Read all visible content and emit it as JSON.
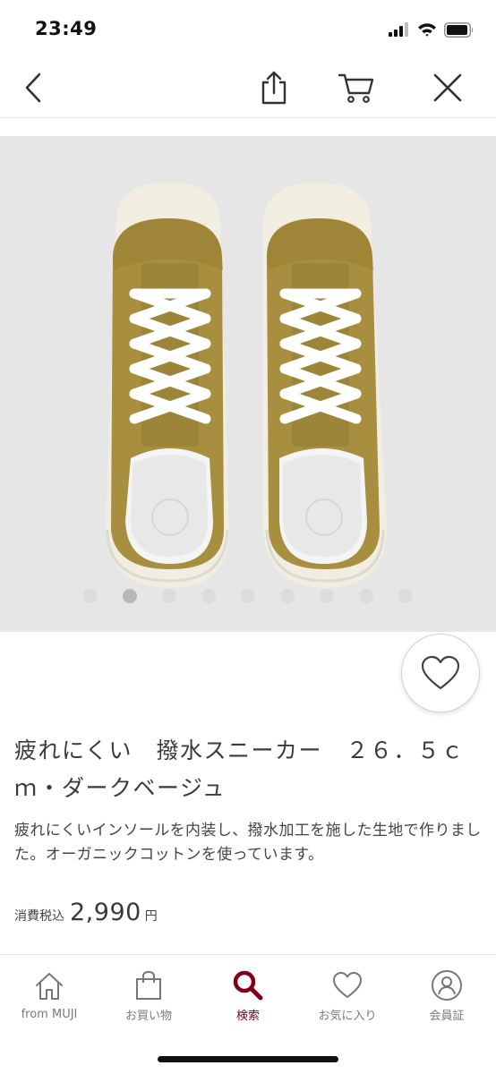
{
  "status_bar": {
    "time": "23:49"
  },
  "product": {
    "title": "疲れにくい　撥水スニーカー　２６．５ｃｍ・ダークベージュ",
    "description": "疲れにくいインソールを内装し、撥水加工を施した生地で作りました。オーガニックコットンを使っています。",
    "price_tax_label": "消費税込",
    "price": "2,990",
    "price_unit": "円",
    "image_count": 9,
    "active_image_index": 1
  },
  "tabs": [
    {
      "label": "from MUJI",
      "icon": "home-icon",
      "active": false
    },
    {
      "label": "お買い物",
      "icon": "shopping-bag-icon",
      "active": false
    },
    {
      "label": "検索",
      "icon": "search-icon",
      "active": true
    },
    {
      "label": "お気に入り",
      "icon": "heart-icon",
      "active": false
    },
    {
      "label": "会員証",
      "icon": "member-card-icon",
      "active": false
    }
  ],
  "colors": {
    "accent": "#7f0019",
    "shoe_canvas": "#a78f3f",
    "sole": "#f1ede0",
    "image_background": "#e6e6e6"
  }
}
